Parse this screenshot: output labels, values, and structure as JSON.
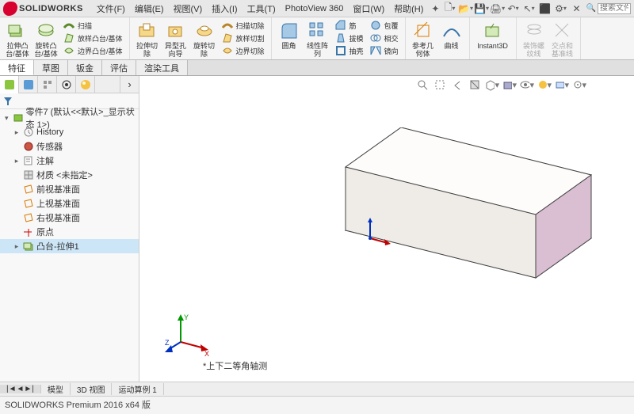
{
  "logo_text": "SOLIDWORKS",
  "menu": {
    "file": "文件(F)",
    "edit": "编辑(E)",
    "view": "视图(V)",
    "insert": "插入(I)",
    "tools": "工具(T)",
    "pv360": "PhotoView 360",
    "window": "窗口(W)",
    "help": "帮助(H)"
  },
  "search_placeholder": "搜索文件",
  "ribbon": {
    "extrude_boss": "拉伸凸\n台/基体",
    "revolve_boss": "旋转凸\n台/基体",
    "sweep": "扫描",
    "loft_boss": "放样凸台/基体",
    "boundary_boss": "边界凸台/基体",
    "extrude_cut": "拉伸切\n除",
    "hole_wizard": "异型孔\n向导",
    "revolve_cut": "旋转切\n除",
    "sweep_cut": "扫描切除",
    "loft_cut": "放样切割",
    "boundary_cut": "边界切除",
    "fillet": "圆角",
    "linear_pattern": "线性阵\n列",
    "rib": "筋",
    "draft": "拔模",
    "shell": "抽壳",
    "wrap": "包覆",
    "intersect": "相交",
    "mirror": "镜向",
    "ref_geom": "参考几\n何体",
    "curves": "曲线",
    "instant3d": "Instant3D",
    "cosmetic_thread": "装饰螺\n纹线",
    "intersect_curve": "交点和\n基准线"
  },
  "doc_tabs": {
    "feature": "特征",
    "sketch": "草图",
    "sheetmetal": "钣金",
    "evaluate": "评估",
    "render": "渲染工具"
  },
  "tree": {
    "root": "零件7 (默认<<默认>_显示状态 1>)",
    "history": "History",
    "sensor": "传感器",
    "notes": "注解",
    "material": "材质 <未指定>",
    "front": "前视基准面",
    "top": "上视基准面",
    "right": "右视基准面",
    "origin": "原点",
    "feat1": "凸台-拉伸1"
  },
  "view_label": "*上下二等角轴测",
  "bottom_tabs": {
    "motion_old": "|◄◄►|",
    "model": "模型",
    "view3d": "3D 视图",
    "motion": "运动算例 1"
  },
  "status": "SOLIDWORKS Premium 2016 x64 版"
}
